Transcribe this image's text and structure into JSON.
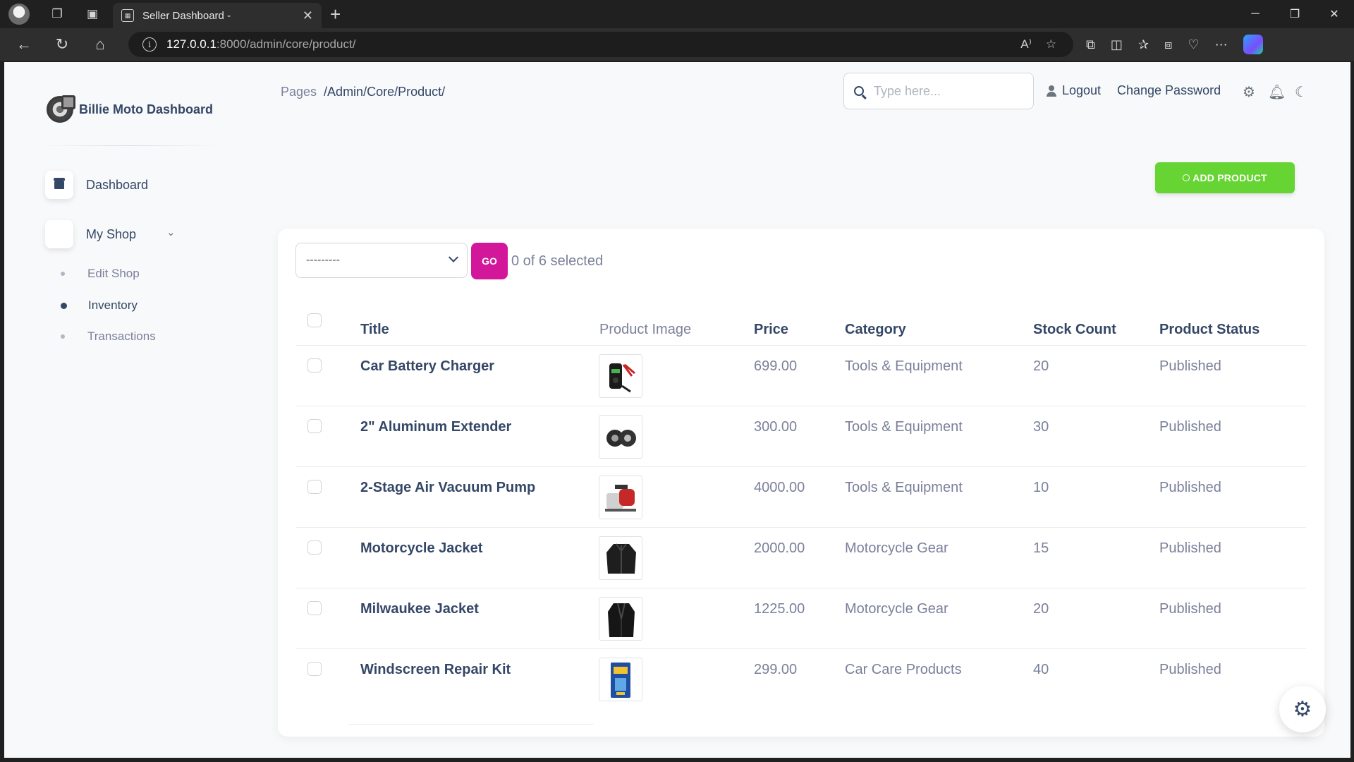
{
  "browser": {
    "tab_title": "Seller Dashboard -",
    "url_host": "127.0.0.1",
    "url_path": ":8000/admin/core/product/"
  },
  "brand": {
    "name": "Billie Moto Dashboard"
  },
  "sidebar": {
    "items": [
      {
        "label": "Dashboard"
      },
      {
        "label": "My Shop"
      }
    ],
    "subitems": [
      {
        "label": "Edit Shop"
      },
      {
        "label": "Inventory",
        "active": true
      },
      {
        "label": "Transactions"
      }
    ]
  },
  "navbar": {
    "breadcrumb_root": "Pages",
    "breadcrumb_path": "/Admin/Core/Product/",
    "search_placeholder": "Type here...",
    "logout": "Logout",
    "change_password": "Change Password"
  },
  "actions": {
    "add_product": "ADD PRODUCT",
    "select_value": "---------",
    "go": "GO",
    "selected_count": "0 of 6 selected"
  },
  "table": {
    "columns": [
      "Title",
      "Product Image",
      "Price",
      "Category",
      "Stock Count",
      "Product Status"
    ],
    "rows": [
      {
        "title": "Car Battery Charger",
        "image": "battery-charger-thumbnail",
        "price": "699.00",
        "category": "Tools & Equipment",
        "stock": "20",
        "status": "Published"
      },
      {
        "title": "2\" Aluminum Extender",
        "image": "aluminum-extender-thumbnail",
        "price": "300.00",
        "category": "Tools & Equipment",
        "stock": "30",
        "status": "Published"
      },
      {
        "title": "2-Stage Air Vacuum Pump",
        "image": "vacuum-pump-thumbnail",
        "price": "4000.00",
        "category": "Tools & Equipment",
        "stock": "10",
        "status": "Published"
      },
      {
        "title": "Motorcycle Jacket",
        "image": "motorcycle-jacket-thumbnail",
        "price": "2000.00",
        "category": "Motorcycle Gear",
        "stock": "15",
        "status": "Published"
      },
      {
        "title": "Milwaukee Jacket",
        "image": "milwaukee-jacket-thumbnail",
        "price": "1225.00",
        "category": "Motorcycle Gear",
        "stock": "20",
        "status": "Published"
      },
      {
        "title": "Windscreen Repair Kit",
        "image": "windscreen-kit-thumbnail",
        "price": "299.00",
        "category": "Car Care Products",
        "stock": "40",
        "status": "Published"
      }
    ]
  },
  "colors": {
    "accent_green": "#66d432",
    "go_magenta": "#d2179a",
    "text_dark": "#344767",
    "text_muted": "#7b809a"
  },
  "icons": [
    "profile-avatar-icon",
    "workspaces-icon",
    "tab-actions-icon",
    "back-icon",
    "reload-icon",
    "home-icon",
    "info-icon",
    "read-aloud-icon",
    "favorite-star-icon",
    "extensions-icon",
    "split-screen-icon",
    "favorites-icon",
    "collections-icon",
    "browser-essentials-icon",
    "more-icon",
    "copilot-icon",
    "turbo-logo-icon",
    "store-icon",
    "chevron-down-icon",
    "search-icon",
    "user-icon",
    "gear-icon",
    "bell-icon",
    "moon-icon",
    "plus-circle-icon"
  ]
}
